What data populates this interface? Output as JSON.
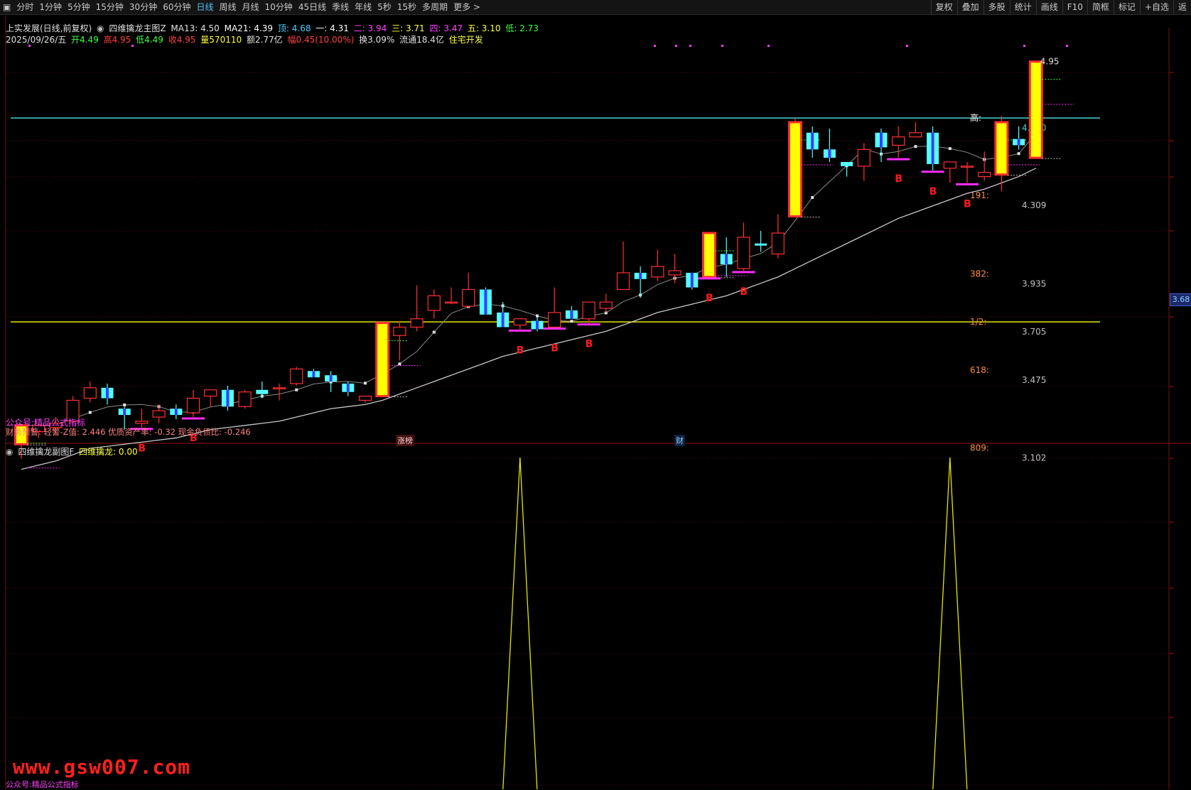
{
  "toolbar": {
    "periods": [
      "分时",
      "1分钟",
      "5分钟",
      "15分钟",
      "30分钟",
      "60分钟",
      "日线",
      "周线",
      "月线",
      "10分钟",
      "45日线",
      "季线",
      "年线",
      "5秒",
      "15秒",
      "多周期",
      "更多 >"
    ],
    "active_period": "日线",
    "right_buttons": [
      "复权",
      "叠加",
      "多股",
      "统计",
      "画线",
      "F10",
      "简框",
      "标记",
      "+自选",
      "返"
    ]
  },
  "info1": {
    "stock": "上实发展(日线,前复权)",
    "indicator": "四维擒龙主图Z",
    "ma13": "MA13: 4.50",
    "ma21": "MA21: 4.39",
    "ding": "顶: 4.68",
    "yi": "一: 4.31",
    "er": "二: 3.94",
    "san": "三: 3.71",
    "si": "四: 3.47",
    "wu": "五: 3.10",
    "di": "低: 2.73"
  },
  "info2": {
    "date": "2025/09/26/五",
    "open": "开4.49",
    "high": "高4.95",
    "low": "低4.49",
    "close": "收4.95",
    "volume": "量570110",
    "amount": "额2.77亿",
    "change": "幅0.45(10.00%)",
    "turnover": "换3.09%",
    "float": "流通18.4亿",
    "sector": "住宅开发"
  },
  "finance_line": "财务预警: 轻警-Z值: 2.446 优质资产率: -0.32 现金负债比: -0.246",
  "gzh_label": "公众号:精品公式指标",
  "sub_title": "四维擒龙副图F",
  "sub_value": "四维擒龙: 0.00",
  "tag_zhangting": "涨榜",
  "tag_cai": "财",
  "price_box": "3.68",
  "watermark": "www.gsw007.com",
  "bottom_note": "公众号:精品公式指标",
  "colors": {
    "up": "#ff3030",
    "down": "#54ffff",
    "limit_fill": "#ffff00",
    "ma": "#c8c8c8",
    "hline_high": "#4ad0d0",
    "hline_half": "#e6e600",
    "fib_label": "#ff8a3d",
    "buy_mark": "#ff1a1a",
    "pink": "#ff2cff"
  },
  "chart_data": {
    "type": "candlestick",
    "price_range": [
      3.07,
      5.0
    ],
    "candles": [
      {
        "o": 3.12,
        "h": 3.21,
        "l": 3.05,
        "c": 3.21,
        "limit": true
      },
      {
        "o": 3.18,
        "h": 3.22,
        "l": 3.15,
        "c": 3.21
      },
      {
        "o": 3.2,
        "h": 3.25,
        "l": 3.17,
        "c": 3.22
      },
      {
        "o": 3.23,
        "h": 3.35,
        "l": 3.22,
        "c": 3.33
      },
      {
        "o": 3.34,
        "h": 3.42,
        "l": 3.32,
        "c": 3.39
      },
      {
        "o": 3.39,
        "h": 3.41,
        "l": 3.31,
        "c": 3.34
      },
      {
        "o": 3.29,
        "h": 3.3,
        "l": 3.19,
        "c": 3.26
      },
      {
        "o": 3.22,
        "h": 3.29,
        "l": 3.2,
        "c": 3.23
      },
      {
        "o": 3.25,
        "h": 3.31,
        "l": 3.22,
        "c": 3.28
      },
      {
        "o": 3.29,
        "h": 3.31,
        "l": 3.24,
        "c": 3.26
      },
      {
        "o": 3.27,
        "h": 3.38,
        "l": 3.25,
        "c": 3.34
      },
      {
        "o": 3.35,
        "h": 3.38,
        "l": 3.3,
        "c": 3.38
      },
      {
        "o": 3.38,
        "h": 3.4,
        "l": 3.28,
        "c": 3.3
      },
      {
        "o": 3.3,
        "h": 3.38,
        "l": 3.29,
        "c": 3.37
      },
      {
        "o": 3.38,
        "h": 3.42,
        "l": 3.34,
        "c": 3.36
      },
      {
        "o": 3.39,
        "h": 3.41,
        "l": 3.33,
        "c": 3.39
      },
      {
        "o": 3.41,
        "h": 3.49,
        "l": 3.4,
        "c": 3.48
      },
      {
        "o": 3.47,
        "h": 3.48,
        "l": 3.44,
        "c": 3.44
      },
      {
        "o": 3.45,
        "h": 3.47,
        "l": 3.37,
        "c": 3.42
      },
      {
        "o": 3.41,
        "h": 3.42,
        "l": 3.35,
        "c": 3.37
      },
      {
        "o": 3.33,
        "h": 3.35,
        "l": 3.32,
        "c": 3.35
      },
      {
        "o": 3.35,
        "h": 3.7,
        "l": 3.35,
        "c": 3.7,
        "limit": true
      },
      {
        "o": 3.64,
        "h": 3.71,
        "l": 3.52,
        "c": 3.68
      },
      {
        "o": 3.68,
        "h": 3.88,
        "l": 3.66,
        "c": 3.72
      },
      {
        "o": 3.76,
        "h": 3.86,
        "l": 3.72,
        "c": 3.83
      },
      {
        "o": 3.8,
        "h": 3.87,
        "l": 3.79,
        "c": 3.8
      },
      {
        "o": 3.78,
        "h": 3.94,
        "l": 3.77,
        "c": 3.86
      },
      {
        "o": 3.86,
        "h": 3.87,
        "l": 3.75,
        "c": 3.74
      },
      {
        "o": 3.75,
        "h": 3.8,
        "l": 3.68,
        "c": 3.68
      },
      {
        "o": 3.69,
        "h": 3.72,
        "l": 3.67,
        "c": 3.72
      },
      {
        "o": 3.71,
        "h": 3.73,
        "l": 3.66,
        "c": 3.67
      },
      {
        "o": 3.68,
        "h": 3.87,
        "l": 3.68,
        "c": 3.75
      },
      {
        "o": 3.76,
        "h": 3.78,
        "l": 3.72,
        "c": 3.72
      },
      {
        "o": 3.72,
        "h": 3.8,
        "l": 3.7,
        "c": 3.8
      },
      {
        "o": 3.77,
        "h": 3.84,
        "l": 3.75,
        "c": 3.8
      },
      {
        "o": 3.86,
        "h": 4.09,
        "l": 3.86,
        "c": 3.94
      },
      {
        "o": 3.94,
        "h": 3.97,
        "l": 3.82,
        "c": 3.91
      },
      {
        "o": 3.92,
        "h": 4.05,
        "l": 3.9,
        "c": 3.97
      },
      {
        "o": 3.93,
        "h": 4.03,
        "l": 3.89,
        "c": 3.95
      },
      {
        "o": 3.94,
        "h": 3.94,
        "l": 3.86,
        "c": 3.87
      },
      {
        "o": 3.92,
        "h": 4.1,
        "l": 3.92,
        "c": 4.13,
        "limit": true
      },
      {
        "o": 4.03,
        "h": 4.11,
        "l": 3.92,
        "c": 3.98
      },
      {
        "o": 3.96,
        "h": 4.18,
        "l": 3.95,
        "c": 4.11
      },
      {
        "o": 4.08,
        "h": 4.14,
        "l": 4.04,
        "c": 4.07
      },
      {
        "o": 4.03,
        "h": 4.22,
        "l": 4.01,
        "c": 4.13
      },
      {
        "o": 4.21,
        "h": 4.68,
        "l": 4.21,
        "c": 4.66,
        "limit": true
      },
      {
        "o": 4.61,
        "h": 4.64,
        "l": 4.49,
        "c": 4.53
      },
      {
        "o": 4.53,
        "h": 4.63,
        "l": 4.47,
        "c": 4.49
      },
      {
        "o": 4.47,
        "h": 4.45,
        "l": 4.4,
        "c": 4.45
      },
      {
        "o": 4.45,
        "h": 4.56,
        "l": 4.38,
        "c": 4.53
      },
      {
        "o": 4.61,
        "h": 4.63,
        "l": 4.47,
        "c": 4.54
      },
      {
        "o": 4.55,
        "h": 4.64,
        "l": 4.49,
        "c": 4.59
      },
      {
        "o": 4.59,
        "h": 4.66,
        "l": 4.59,
        "c": 4.61
      },
      {
        "o": 4.61,
        "h": 4.64,
        "l": 4.43,
        "c": 4.46
      },
      {
        "o": 4.44,
        "h": 4.47,
        "l": 4.37,
        "c": 4.47
      },
      {
        "o": 4.45,
        "h": 4.47,
        "l": 4.37,
        "c": 4.45
      },
      {
        "o": 4.4,
        "h": 4.52,
        "l": 4.38,
        "c": 4.42
      },
      {
        "o": 4.41,
        "h": 4.69,
        "l": 4.33,
        "c": 4.66,
        "limit": true
      },
      {
        "o": 4.58,
        "h": 4.64,
        "l": 4.53,
        "c": 4.55
      },
      {
        "o": 4.49,
        "h": 4.95,
        "l": 4.49,
        "c": 4.95,
        "limit": true
      }
    ],
    "ma": [
      3.0,
      3.02,
      3.04,
      3.07,
      3.1,
      3.11,
      3.12,
      3.13,
      3.14,
      3.15,
      3.17,
      3.19,
      3.2,
      3.21,
      3.22,
      3.23,
      3.25,
      3.27,
      3.29,
      3.3,
      3.31,
      3.33,
      3.36,
      3.39,
      3.42,
      3.45,
      3.48,
      3.51,
      3.54,
      3.56,
      3.58,
      3.6,
      3.62,
      3.64,
      3.66,
      3.69,
      3.72,
      3.75,
      3.77,
      3.79,
      3.81,
      3.83,
      3.86,
      3.89,
      3.92,
      3.96,
      4.0,
      4.04,
      4.08,
      4.12,
      4.16,
      4.2,
      4.23,
      4.26,
      4.29,
      4.32,
      4.34,
      4.37,
      4.4,
      4.44
    ],
    "buy_signals": [
      7,
      10,
      29,
      31,
      33,
      40,
      42,
      51,
      53,
      55
    ],
    "hline_high": 4.68,
    "hline_half": 3.705,
    "fib_levels": [
      {
        "label": "高:",
        "price": 4.68,
        "value": "4.680"
      },
      {
        "label": "191:",
        "price": 4.31,
        "value": "4.309"
      },
      {
        "label": "382:",
        "price": 3.935,
        "value": "3.935"
      },
      {
        "label": "1/2:",
        "price": 3.705,
        "value": "3.705"
      },
      {
        "label": "618:",
        "price": 3.475,
        "value": "3.475"
      },
      {
        "label": "809:",
        "price": 3.102,
        "value": "3.102"
      }
    ],
    "sub_peaks": [
      29,
      54
    ],
    "last_price": "4.95"
  }
}
